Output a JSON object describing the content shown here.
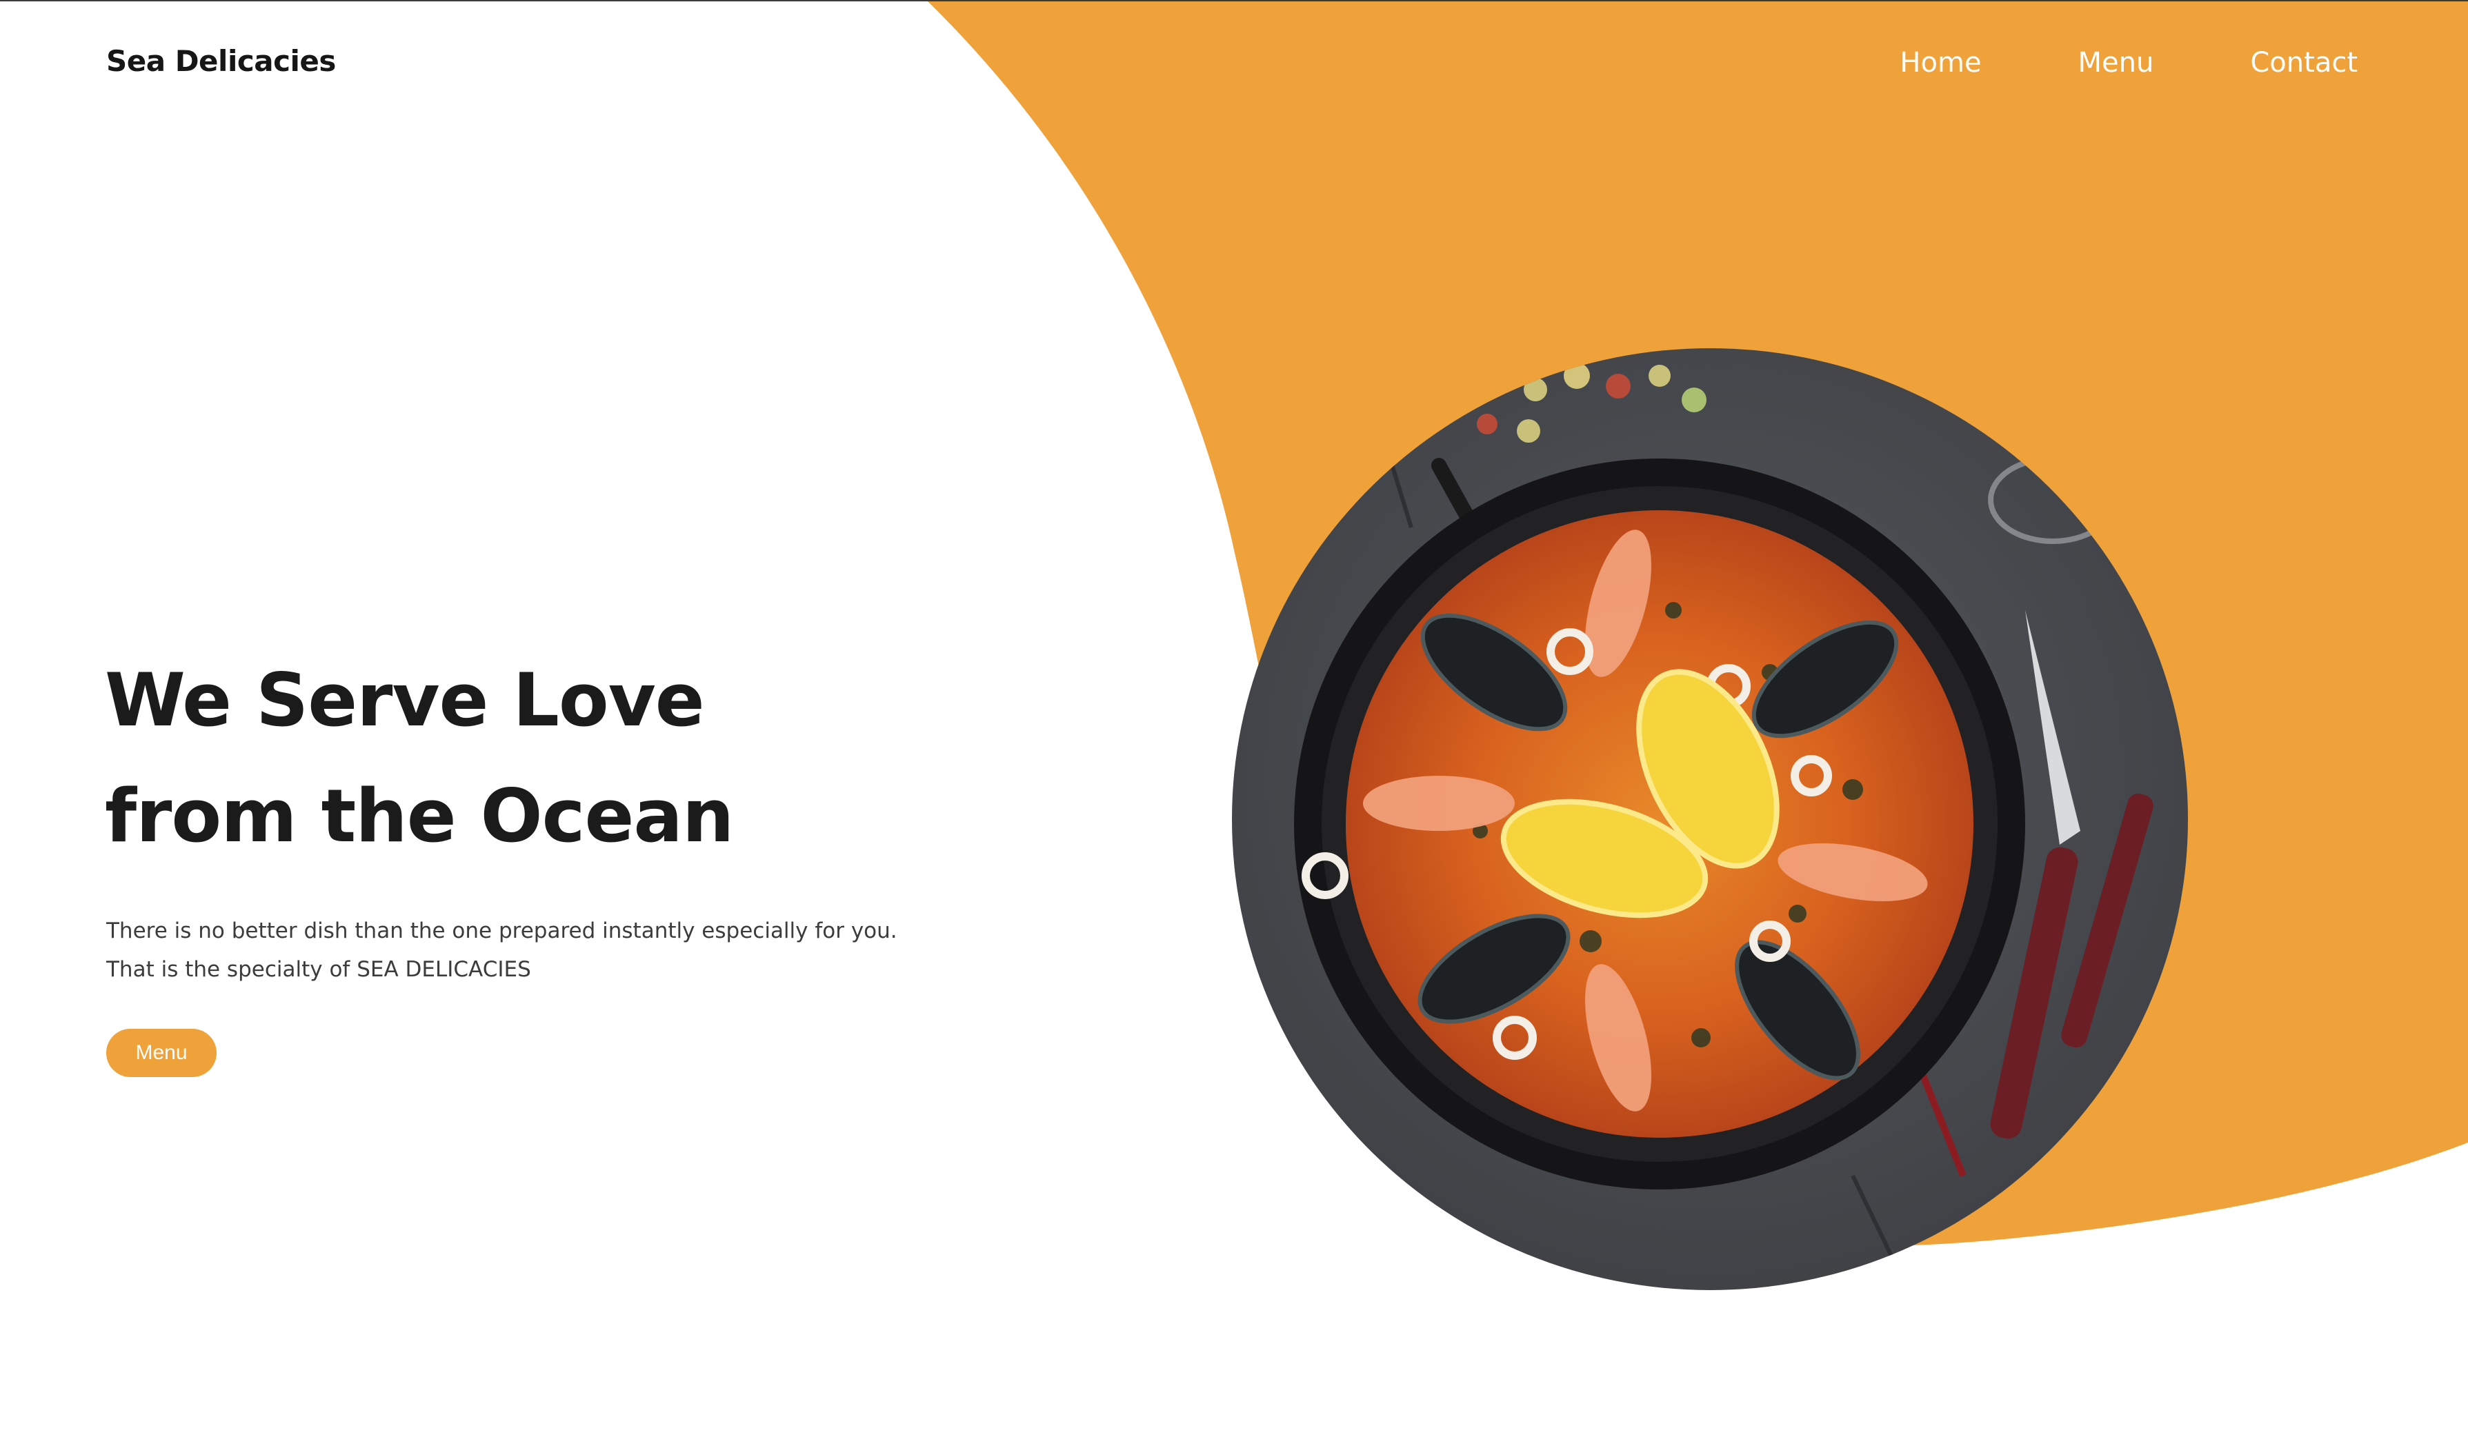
{
  "brand": {
    "name": "Sea Delicacies",
    "accent_color": "#f0a23a",
    "text_color": "#1b1b1b"
  },
  "nav": {
    "items": [
      {
        "label": "Home"
      },
      {
        "label": "Menu"
      },
      {
        "label": "Contact"
      }
    ]
  },
  "hero": {
    "title_line1": "We Serve Love",
    "title_line2": "from the Ocean",
    "text_line1": "There is no better dish than the one prepared instantly especially for you.",
    "text_line2": "That is the specialty of SEA DELICACIES",
    "button_label": "Menu"
  },
  "image": {
    "subject": "seafood paella in a black pan with lemon, mussels, shrimp and calamari",
    "icon": "paella-dish-image"
  }
}
